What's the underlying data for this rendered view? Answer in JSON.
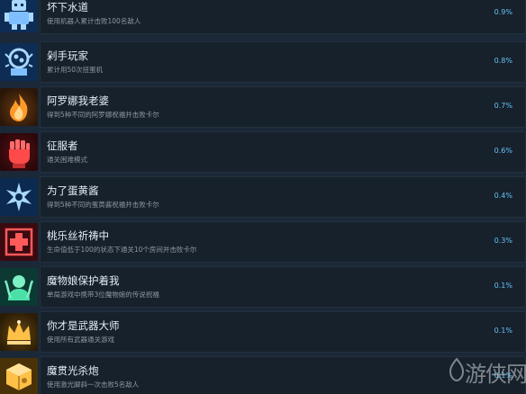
{
  "achievements": [
    {
      "title": "坏下水道",
      "desc": "使用机器人累计击败100名敌人",
      "percent": "0.9%",
      "icon": "robot-icon",
      "color": "#6fb2ff"
    },
    {
      "title": "剁手玩家",
      "desc": "累计用50次扭蛋机",
      "percent": "0.8%",
      "icon": "gashapon-icon",
      "color": "#6fb2ff"
    },
    {
      "title": "阿罗娜我老婆",
      "desc": "得到5种不同的阿罗娜祝福并击败卡尔",
      "percent": "0.7%",
      "icon": "flame-icon",
      "color": "#ff9a2a"
    },
    {
      "title": "征服者",
      "desc": "通关困难模式",
      "percent": "0.6%",
      "icon": "fist-icon",
      "color": "#ff4a4a"
    },
    {
      "title": "为了蛋黄酱",
      "desc": "得到5种不同的蛋黄酱祝福并击败卡尔",
      "percent": "0.4%",
      "icon": "star-icon",
      "color": "#7fc4ff"
    },
    {
      "title": "桃乐丝祈祷中",
      "desc": "生命值低于100的状态下通关10个房间并击败卡尔",
      "percent": "0.3%",
      "icon": "cross-icon",
      "color": "#ff4a4a"
    },
    {
      "title": "魔物娘保护着我",
      "desc": "单局游戏中携带3位魔物娘的传说祝福",
      "percent": "0.1%",
      "icon": "monster-icon",
      "color": "#4be0a8"
    },
    {
      "title": "你才是武器大师",
      "desc": "使用所有武器通关游戏",
      "percent": "0.1%",
      "icon": "crown-icon",
      "color": "#ffc048"
    },
    {
      "title": "魔贯光杀炮",
      "desc": "使用激光脚斜一次击败5名敌人",
      "percent": "0.1%",
      "icon": "cube-icon",
      "color": "#ffc048"
    }
  ],
  "watermark": {
    "text": "游侠网"
  }
}
